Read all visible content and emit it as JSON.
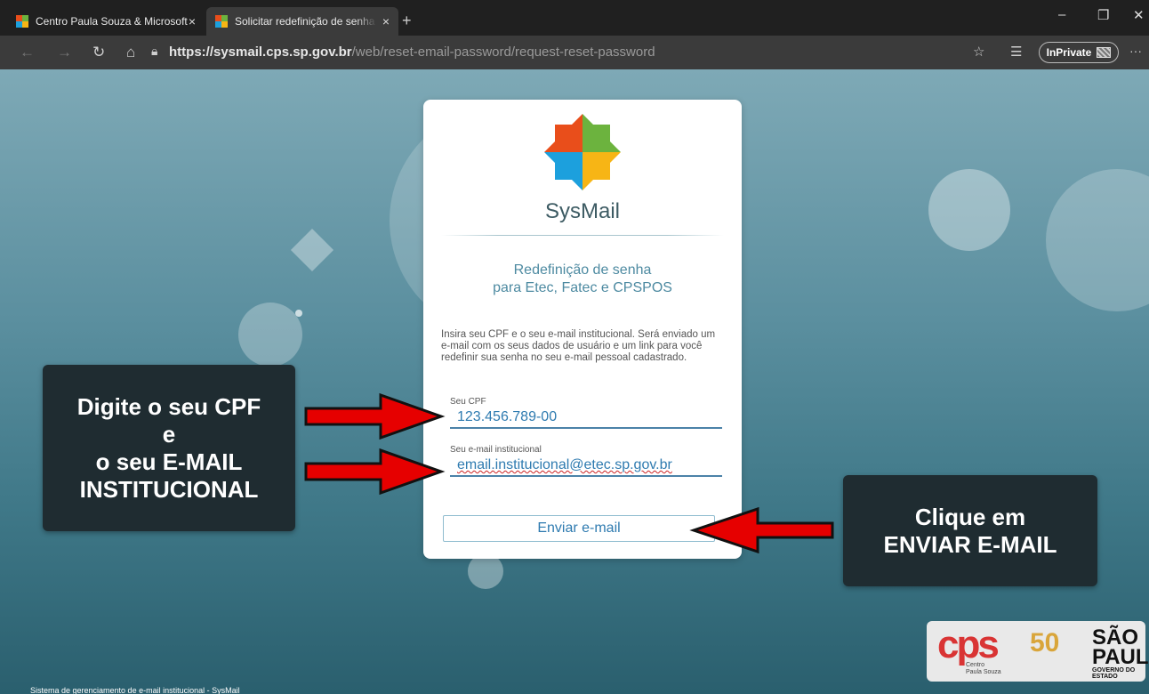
{
  "browser": {
    "tabs": [
      {
        "title": "Centro Paula Souza & Microsoft",
        "close": "×"
      },
      {
        "title": "Solicitar redefinição de senha do",
        "close": "×"
      }
    ],
    "new_tab": "+",
    "window_controls": {
      "minimize": "–",
      "restore": "❐",
      "close": "✕"
    },
    "nav": {
      "back": "←",
      "forward": "→",
      "refresh": "↻",
      "home": "⌂"
    },
    "url_host": "https://sysmail.cps.sp.gov.br",
    "url_path": "/web/reset-email-password/request-reset-password",
    "favorite_icon": "☆",
    "favorites_bar_icon": "☰",
    "inprivate_label": "InPrivate",
    "more_icon": "···"
  },
  "card": {
    "app_name": "SysMail",
    "subtitle_line1": "Redefinição de senha",
    "subtitle_line2": "para Etec, Fatec e CPSPOS",
    "instructions": "Insira seu CPF e o seu e-mail institucional. Será enviado um e-mail com os seus dados de usuário e um link para você redefinir sua senha no seu e-mail pessoal cadastrado.",
    "cpf_label": "Seu CPF",
    "cpf_value": "123.456.789-00",
    "email_label": "Seu e-mail institucional",
    "email_value": "email.institucional@etec.sp.gov.br",
    "send_button": "Enviar e-mail"
  },
  "callouts": {
    "left_lines": [
      "Digite o seu CPF",
      "e",
      "o seu E-MAIL",
      "INSTITUCIONAL"
    ],
    "right_lines": [
      "Clique em",
      "ENVIAR E-MAIL"
    ]
  },
  "footer": "Sistema de gerenciamento de e-mail institucional - SysMail",
  "brand": {
    "cps": "cps",
    "cps_sub_1": "Centro",
    "cps_sub_2": "Paula Souza",
    "anos": "50",
    "sp_1": "SÃO",
    "sp_2": "PAULO",
    "gov": "GOVERNO DO ESTADO"
  },
  "colors": {
    "arrow": "#e60000",
    "accent": "#2f7bb0",
    "callout_bg": "#1f2c31"
  }
}
